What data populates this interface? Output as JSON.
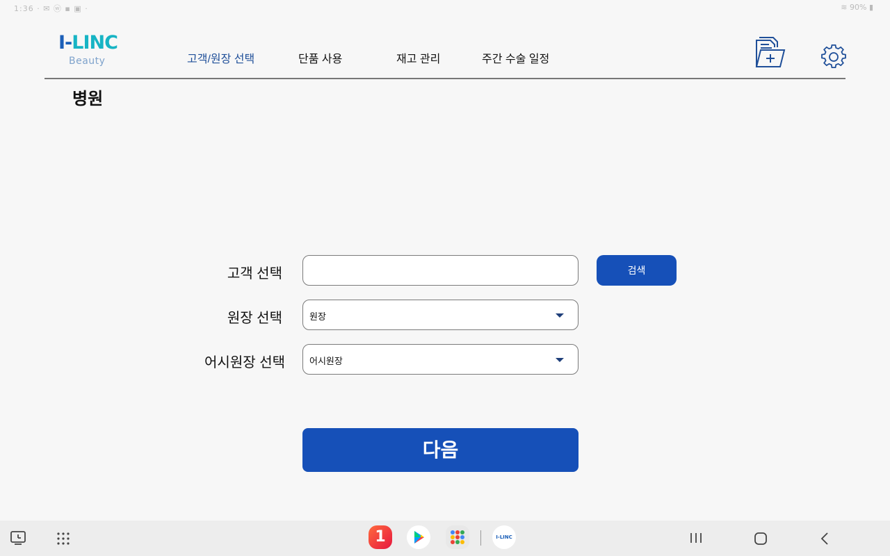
{
  "status": {
    "left": "1:36 · ✉ ⓦ ▪ ▣ ·",
    "right": "≋ 90% ▮"
  },
  "header": {
    "logo_main_a": "I-",
    "logo_main_b": "LINC",
    "logo_sub": "Beauty",
    "tabs": [
      {
        "label": "고객/원장 선택",
        "active": true
      },
      {
        "label": "단품 사용",
        "active": false
      },
      {
        "label": "재고 관리",
        "active": false
      },
      {
        "label": "주간 수술 일정",
        "active": false
      }
    ]
  },
  "page": {
    "title": "병원"
  },
  "form": {
    "customer_label": "고객 선택",
    "customer_value": "",
    "search_label": "검색",
    "director_label": "원장 선택",
    "director_value": "원장",
    "assistant_label": "어시원장 선택",
    "assistant_value": "어시원장",
    "next_label": "다음"
  },
  "taskbar": {
    "app_one_label": "1",
    "app_ilinc_label": "I-LINC"
  },
  "colors": {
    "accent": "#1650b8",
    "active_tab": "#1f4f99",
    "logo_blue": "#1b5fb8",
    "logo_teal": "#17b4c4"
  }
}
